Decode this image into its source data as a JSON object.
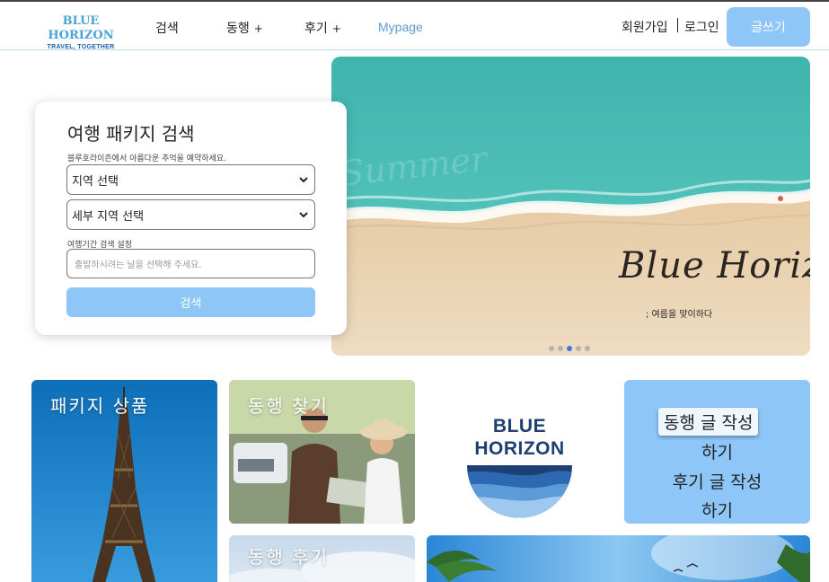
{
  "header": {
    "logo_main": "BLUE HORIZON",
    "logo_sub": "TRAVEL, TOGETHER",
    "nav": [
      {
        "label": "검색",
        "plus": ""
      },
      {
        "label": "동행",
        "plus": "+"
      },
      {
        "label": "후기",
        "plus": "+"
      }
    ],
    "mypage": "Mypage",
    "signup": "회원가입",
    "login": "로그인",
    "write_button": "글쓰기"
  },
  "search": {
    "title": "여행 패키지 검색",
    "description": "블루호라이즌에서 아름다운 추억을 예약하세요.",
    "region_select": "지역 선택",
    "subregion_select": "세부 지역 선택",
    "date_label": "여행기간 검색 설정",
    "date_placeholder": "출발하시려는 날을 선택해 주세요.",
    "submit": "검색"
  },
  "hero": {
    "script_title": "Blue Horizon",
    "subtitle": "; 여름을 맞이하다",
    "faint_text": "Summer",
    "slides": 5,
    "active_slide": 3
  },
  "tiles": {
    "packages": "패키지 상품",
    "find_companion": "동행 찾기",
    "brand_logo_line1": "BLUE",
    "brand_logo_line2": "HORIZON",
    "write_companion_a": "동행 글 작성",
    "write_companion_b": "하기",
    "write_review_a": "후기 글 작성",
    "write_review_b": "하기",
    "companion_review": "동행 후기"
  },
  "colors": {
    "accent": "#8ec6f8",
    "logo_blue": "#4aa3d6",
    "brand_navy": "#1e3f74",
    "mypage_link": "#5a9ad6"
  }
}
